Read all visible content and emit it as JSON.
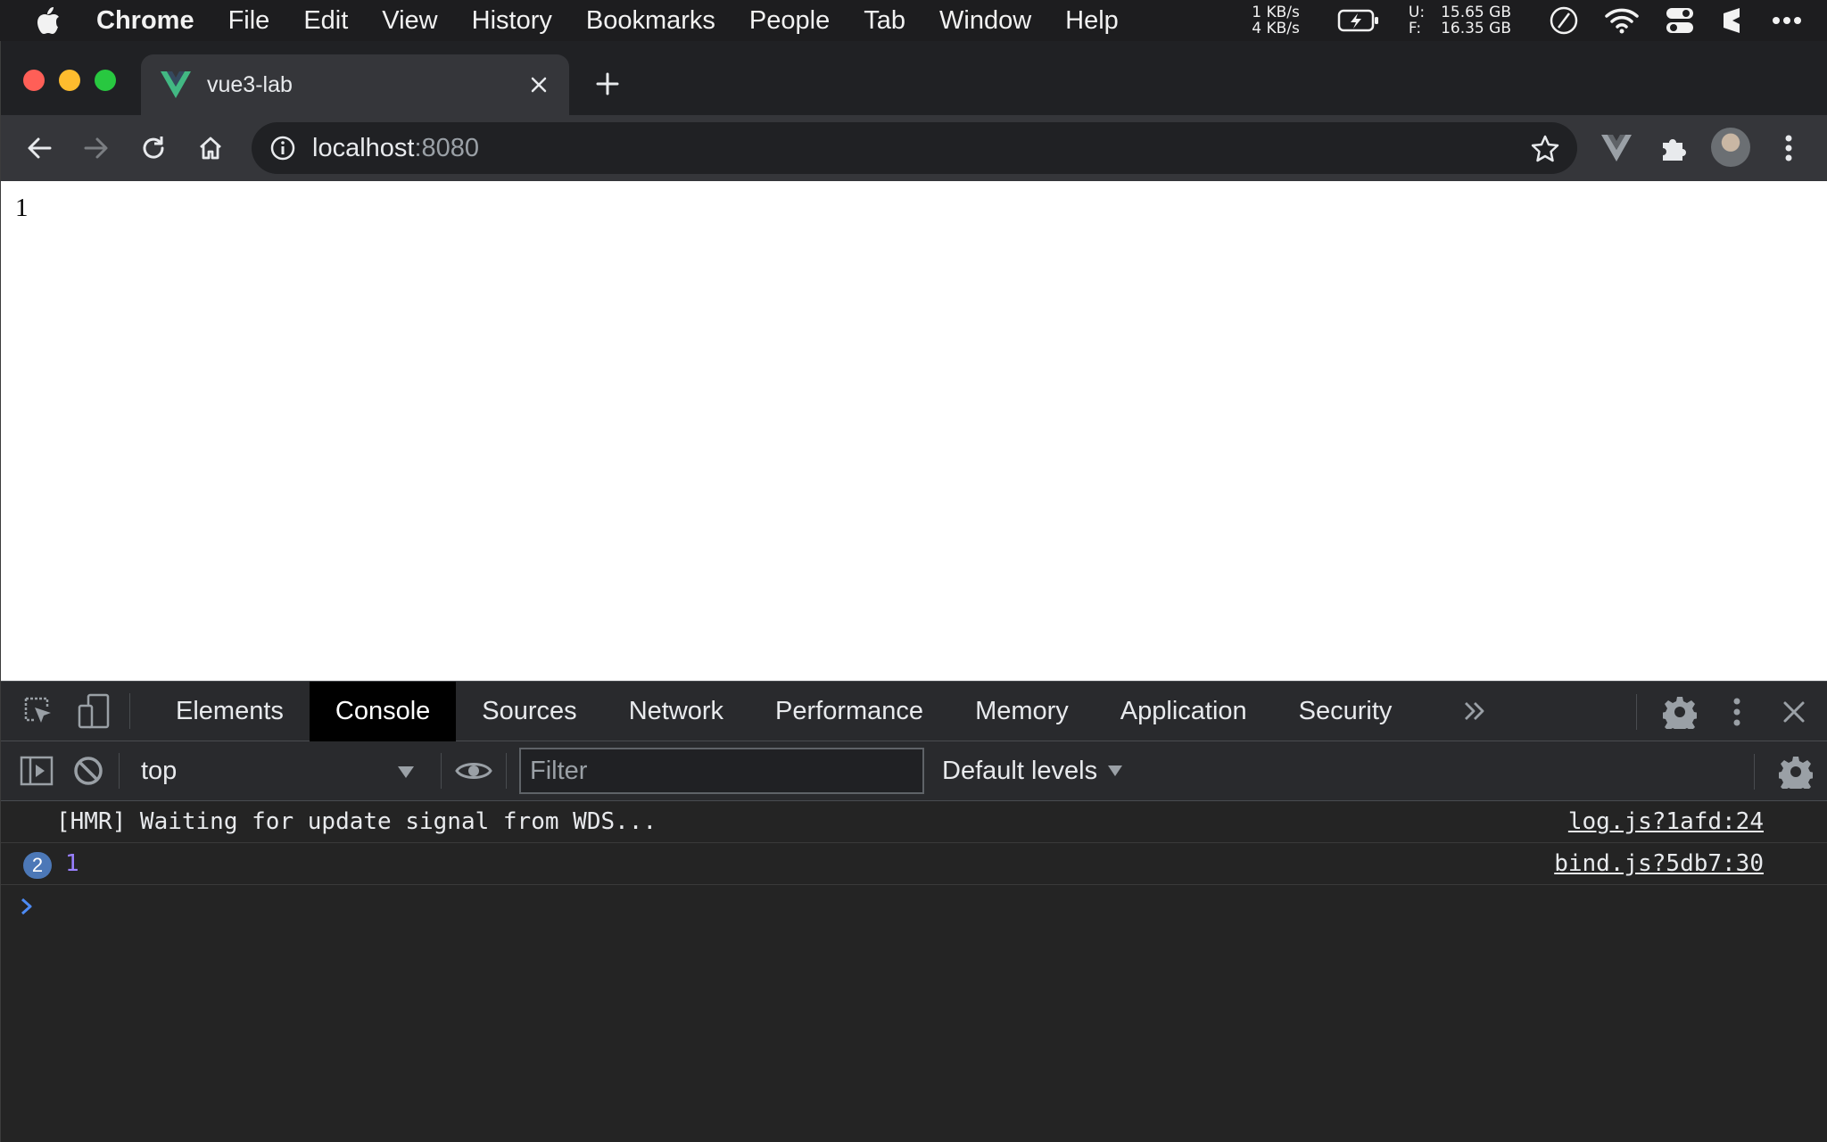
{
  "menubar": {
    "app_name": "Chrome",
    "items": [
      "File",
      "Edit",
      "View",
      "History",
      "Bookmarks",
      "People",
      "Tab",
      "Window",
      "Help"
    ],
    "net_up": "1 KB/s",
    "net_down": "4 KB/s",
    "mem_u_label": "U:",
    "mem_u_value": "15.65 GB",
    "mem_f_label": "F:",
    "mem_f_value": "16.35 GB"
  },
  "browser": {
    "tab_title": "vue3-lab",
    "url_host": "localhost",
    "url_port": ":8080"
  },
  "page": {
    "content": "1"
  },
  "devtools": {
    "tabs": [
      "Elements",
      "Console",
      "Sources",
      "Network",
      "Performance",
      "Memory",
      "Application",
      "Security"
    ],
    "active_tab": "Console",
    "context": "top",
    "filter_placeholder": "Filter",
    "levels": "Default levels",
    "logs": [
      {
        "message": "[HMR] Waiting for update signal from WDS...",
        "source": "log.js?1afd:24"
      },
      {
        "count": "2",
        "message": "1",
        "source": "bind.js?5db7:30"
      }
    ]
  },
  "colors": {
    "vue_green": "#42b883",
    "console_number": "#9980ff",
    "prompt_blue": "#4d8bf5"
  }
}
